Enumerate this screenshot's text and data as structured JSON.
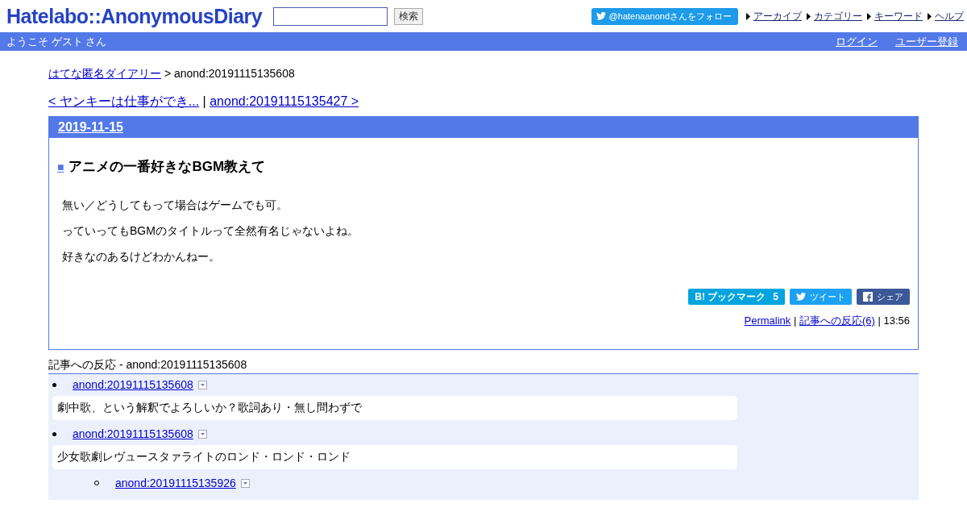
{
  "header": {
    "logo": "Hatelabo::AnonymousDiary",
    "search": {
      "button": "検索"
    },
    "follow": "@hatenaanondさんをフォロー",
    "links": [
      "アーカイブ",
      "カテゴリー",
      "キーワード",
      "ヘルプ"
    ]
  },
  "bar": {
    "welcome": "ようこそ ゲスト さん",
    "links": [
      "ログイン",
      "ユーザー登録"
    ]
  },
  "breadcrumb": {
    "link": "はてな匿名ダイアリー",
    "current": "> anond:20191115135608"
  },
  "nav": {
    "prev": "< ヤンキーは仕事ができ...",
    "sep": "|",
    "next": "anond:20191115135427 >"
  },
  "entry": {
    "date": "2019-11-15",
    "marker": "■",
    "title": "アニメの一番好きなBGM教えて",
    "paragraphs": [
      "無い／どうしてもって場合はゲームでも可。",
      "っていってもBGMのタイトルって全然有名じゃないよね。",
      "好きなのあるけどわかんねー。"
    ],
    "share": [
      {
        "kind": "bookmark",
        "label": "B! ブックマーク",
        "count": "5"
      },
      {
        "kind": "tweet",
        "label": "ツイート"
      },
      {
        "kind": "facebook",
        "label": "シェア"
      }
    ],
    "footer": {
      "permalink": "Permalink",
      "sep1": "|",
      "reactions": "記事への反応(6)",
      "sep2": "|",
      "time": "13:56"
    }
  },
  "responses": {
    "title": "記事への反応 - anond:20191115135608",
    "items": [
      {
        "link": "anond:20191115135608",
        "text": "劇中歌、という解釈でよろしいか？歌詞あり・無し問わずで"
      },
      {
        "link": "anond:20191115135608",
        "text": "少女歌劇レヴュースタァライトのロンド・ロンド・ロンド",
        "children": [
          {
            "link": "anond:20191115135926"
          }
        ]
      }
    ]
  }
}
